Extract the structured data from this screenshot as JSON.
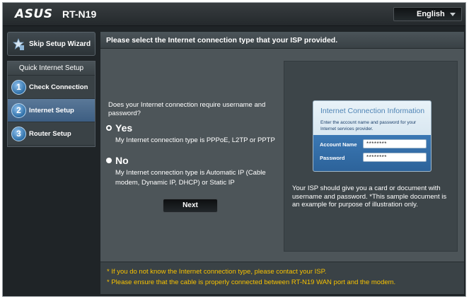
{
  "header": {
    "logo": "ASUS",
    "model": "RT-N19",
    "language": {
      "value": "English",
      "icon": "chevron-down-icon"
    }
  },
  "sidebar": {
    "skip_button": {
      "label": "Skip Setup Wizard",
      "icon": "wizard-skip-icon"
    },
    "steps_title": "Quick Internet Setup",
    "steps": [
      {
        "number": "1",
        "label": "Check Connection",
        "active": false
      },
      {
        "number": "2",
        "label": "Internet Setup",
        "active": true
      },
      {
        "number": "3",
        "label": "Router Setup",
        "active": false
      }
    ]
  },
  "main": {
    "title": "Please select the Internet connection type that your ISP provided.",
    "question": "Does your Internet connection require username and password?",
    "options": [
      {
        "title": "Yes",
        "description": "My Internet connection type is PPPoE, L2TP or PPTP",
        "selected": true
      },
      {
        "title": "No",
        "description": "My Internet connection type is Automatic IP (Cable modem, Dynamic IP, DHCP) or Static IP",
        "selected": false
      }
    ],
    "next_label": "Next",
    "info_card": {
      "title": "Internet Connection Information",
      "subtitle": "Enter the account name and password for your Internet services provider.",
      "account_label": "Account Name",
      "account_value": "********",
      "password_label": "Password",
      "password_value": "********"
    },
    "isp_note": "Your ISP should give you a card or document with username and password. *This sample document is an example for purpose of illustration only."
  },
  "footer": {
    "notes": [
      "* If you do not know the Internet connection type, please contact your ISP.",
      "* Please ensure that the cable is properly connected between RT-N19 WAN port and the modem."
    ]
  },
  "colors": {
    "background": "#1f2427",
    "panel": "#4d5559",
    "accent_blue": "#3d5e82",
    "note_yellow": "#f7c200"
  }
}
